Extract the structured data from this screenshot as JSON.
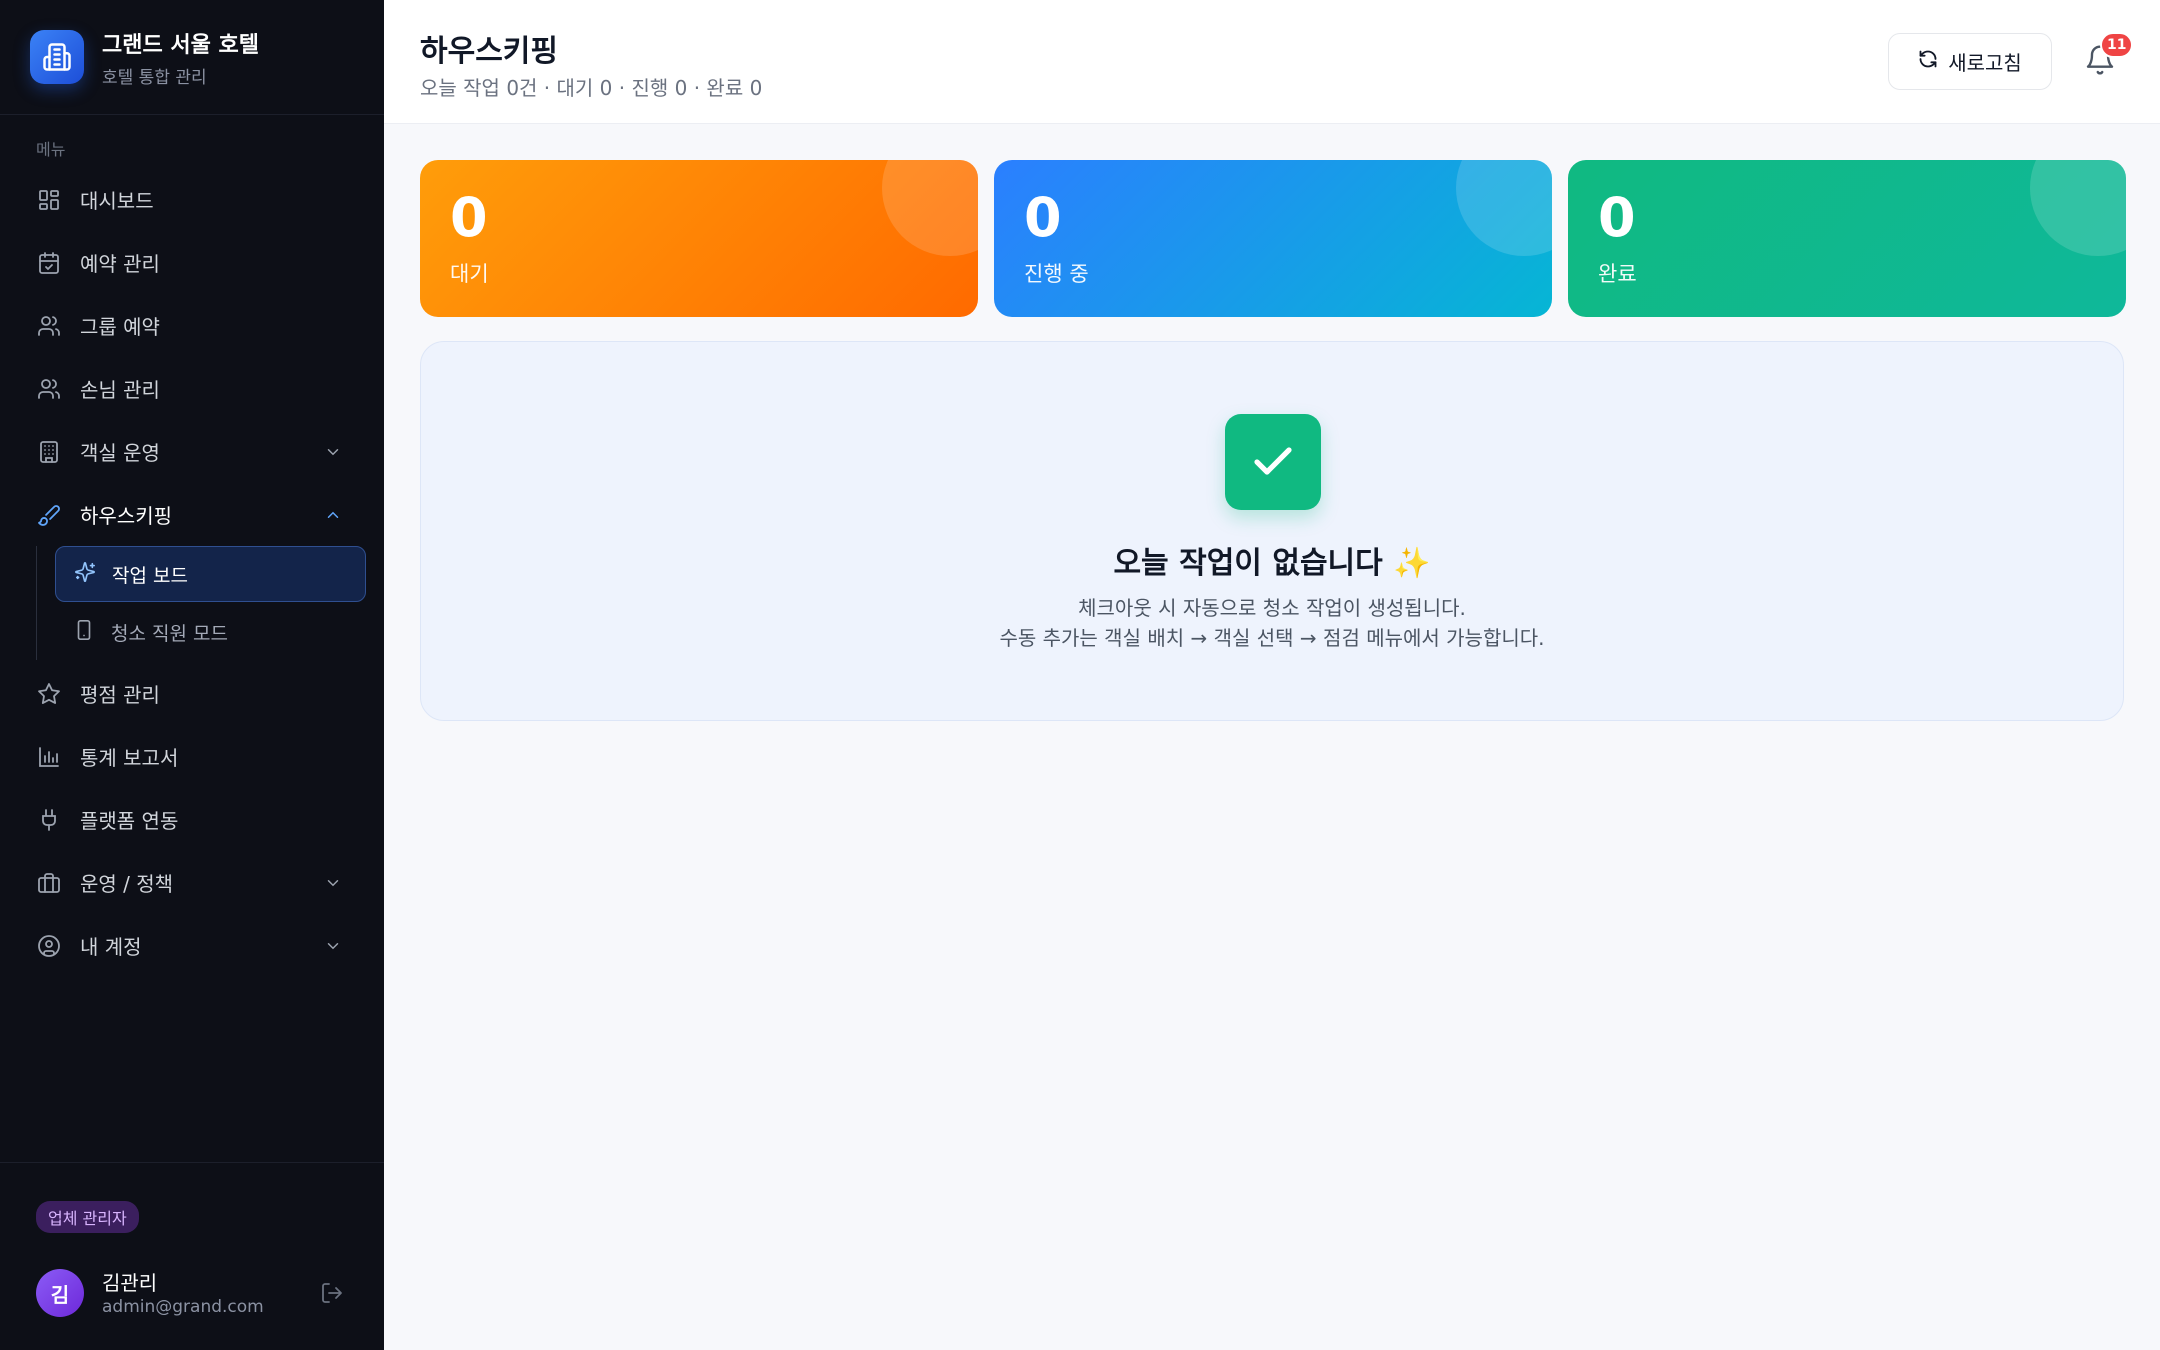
{
  "brand": {
    "title": "그랜드 서울 호텔",
    "subtitle": "호텔 통합 관리",
    "accent": "#2563eb"
  },
  "sidebar": {
    "menu_label": "메뉴",
    "items": [
      {
        "label": "대시보드",
        "icon": "grid-icon"
      },
      {
        "label": "예약 관리",
        "icon": "calendar-check-icon"
      },
      {
        "label": "그룹 예약",
        "icon": "users-icon"
      },
      {
        "label": "손님 관리",
        "icon": "users-icon"
      },
      {
        "label": "객실 운영",
        "icon": "building-icon",
        "expandable": true
      },
      {
        "label": "하우스키핑",
        "icon": "brush-icon",
        "expanded": true,
        "active": true
      },
      {
        "label": "평점 관리",
        "icon": "star-icon"
      },
      {
        "label": "통계 보고서",
        "icon": "bar-chart-icon"
      },
      {
        "label": "플랫폼 연동",
        "icon": "plug-icon"
      },
      {
        "label": "운영 / 정책",
        "icon": "briefcase-icon",
        "expandable": true
      },
      {
        "label": "내 계정",
        "icon": "user-circle-icon",
        "expandable": true
      }
    ],
    "housekeeping_sub": [
      {
        "label": "작업 보드",
        "icon": "sparkles-icon",
        "active": true
      },
      {
        "label": "청소 직원 모드",
        "icon": "phone-icon"
      }
    ],
    "footer": {
      "role": "업체 관리자",
      "avatar_initial": "김",
      "user_name": "김관리",
      "user_email": "admin@grand.com"
    }
  },
  "header": {
    "title": "하우스키핑",
    "subtitle": "오늘 작업 0건 · 대기 0 · 진행 0 · 완료 0",
    "refresh_label": "새로고침",
    "notification_count": "11"
  },
  "stats": [
    {
      "value": "0",
      "label": "대기",
      "color": "#ff8a00"
    },
    {
      "value": "0",
      "label": "진행 중",
      "color": "#1e90ff"
    },
    {
      "value": "0",
      "label": "완료",
      "color": "#10b981"
    }
  ],
  "empty_state": {
    "title": "오늘 작업이 없습니다 ✨",
    "line1": "체크아웃 시 자동으로 청소 작업이 생성됩니다.",
    "line2": "수동 추가는 객실 배치 → 객실 선택 → 점검 메뉴에서 가능합니다."
  }
}
